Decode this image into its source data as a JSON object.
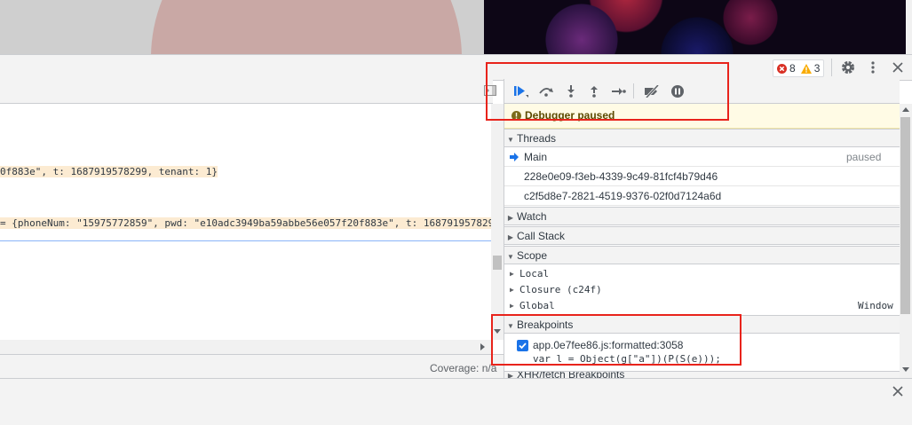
{
  "topbar": {
    "errors_count": "8",
    "warnings_count": "3"
  },
  "code": {
    "line1": "0f883e\", t: 1687919578299, tenant: 1}",
    "line2": "= {phoneNum: \"15975772859\", pwd: \"e10adc3949ba59abbe56e057f20f883e\", t: 168791957829"
  },
  "status": {
    "coverage": "Coverage: n/a"
  },
  "debugger": {
    "paused_label": "Debugger paused",
    "threads_header": "Threads",
    "threads": [
      {
        "name": "Main",
        "status": "paused"
      },
      {
        "name": "228e0e09-f3eb-4339-9c49-81fcf4b79d46",
        "status": ""
      },
      {
        "name": "c2f5d8e7-2821-4519-9376-02f0d7124a6d",
        "status": ""
      }
    ],
    "watch_header": "Watch",
    "callstack_header": "Call Stack",
    "scope_header": "Scope",
    "scope_items": [
      {
        "name": "Local",
        "value": ""
      },
      {
        "name": "Closure (c24f)",
        "value": ""
      },
      {
        "name": "Global",
        "value": "Window"
      }
    ],
    "breakpoints_header": "Breakpoints",
    "breakpoint": {
      "file": "app.0e7fee86.js:formatted:3058",
      "code": "var l = Object(g[\"a\"])(P(S(e)));"
    },
    "xhr_header": "XHR/fetch Breakpoints"
  },
  "colors": {
    "error": "#d93025",
    "warning": "#f9ab00",
    "accent": "#1a73e8",
    "annotation": "#e8231b"
  }
}
